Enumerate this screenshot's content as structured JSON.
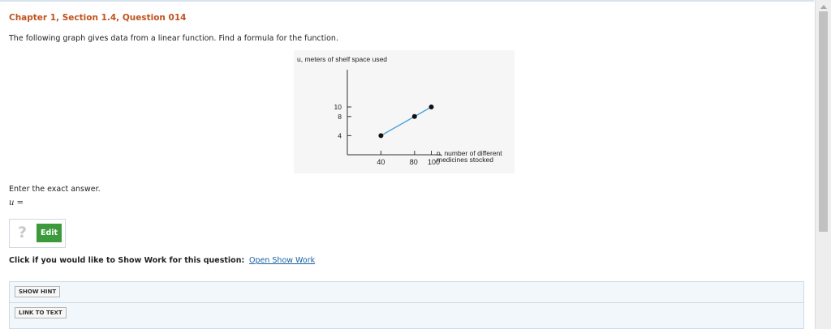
{
  "question": {
    "title": "Chapter 1, Section 1.4, Question 014",
    "prompt": "The following graph gives data from a linear function. Find a formula for the function.",
    "enter_instruction": "Enter the exact answer.",
    "answer_label": "u ="
  },
  "chart_data": {
    "type": "scatter",
    "ylabel": "u, meters of shelf space used",
    "xlabel_line1": "n, number of different",
    "xlabel_line2": "medicines stocked",
    "x_ticks": [
      "40",
      "80",
      "100"
    ],
    "y_ticks": [
      "10",
      "8",
      "4"
    ],
    "points": [
      {
        "x": 40,
        "y": 4
      },
      {
        "x": 80,
        "y": 8
      },
      {
        "x": 100,
        "y": 10
      }
    ],
    "line_color": "#4da3dc",
    "point_color": "#111111"
  },
  "answer": {
    "help_glyph": "?",
    "edit_label": "Edit"
  },
  "show_work": {
    "prompt": "Click if you would like to Show Work for this question:",
    "link_label": "Open Show Work"
  },
  "buttons": {
    "show_hint": "SHOW HINT",
    "link_to_text": "LINK TO TEXT"
  }
}
